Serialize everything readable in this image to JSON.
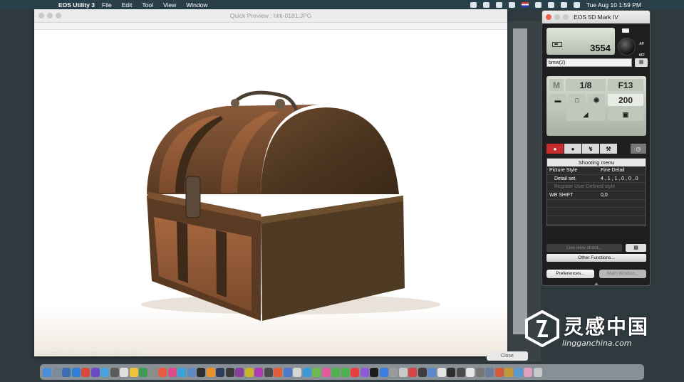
{
  "menubar": {
    "app_name": "EOS Utility 3",
    "items": [
      "File",
      "Edit",
      "Tool",
      "View",
      "Window"
    ],
    "clock": "Tue Aug 10  1:59 PM"
  },
  "preview_window": {
    "title": "Quick Preview : hilti-0181.JPG"
  },
  "status_text": "To control the focus, set the lens switch to [AF].",
  "close_label": "Close",
  "camera_panel": {
    "title": "EOS 5D Mark IV",
    "shots_remaining": "3554",
    "side_labels": [
      "AF",
      "MF"
    ],
    "owner": "bmw(2)",
    "mode": "M",
    "shutter": "1/8",
    "aperture": "F13",
    "iso": "200",
    "tabs": [
      "shooting-tab",
      "camera-settings-tab",
      "flash-tab",
      "tools-tab",
      "timer-tab"
    ],
    "menu_title": "Shooting menu",
    "menu_rows": [
      {
        "label": "Picture Style",
        "value": "Fine Detail"
      },
      {
        "label": "Detail set.",
        "value": "4 , 1 , 1 , 0 , 0 , 0"
      },
      {
        "label": "Register User Defined style",
        "value": ""
      },
      {
        "label": "WB SHIFT",
        "value": "0,0"
      }
    ],
    "live_view_label": "Live view shoot...",
    "other_functions_label": "Other Functions...",
    "preferences_label": "Preferences...",
    "main_window_label": "Main Window..."
  },
  "watermark": {
    "cn": "灵感中国",
    "en": "lingganchina.com"
  },
  "colors": {
    "menubar": "#29404a",
    "active_tab": "#c62d2d",
    "lcd": "#c1c8bb"
  }
}
